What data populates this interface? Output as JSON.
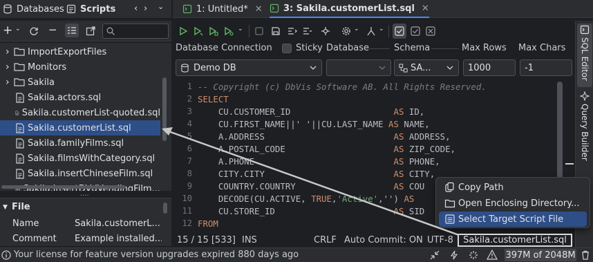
{
  "left_tabs": {
    "databases": "Databases",
    "scripts": "Scripts"
  },
  "tree": [
    {
      "label": "ImportExportFiles",
      "type": "folder"
    },
    {
      "label": "Monitors",
      "type": "folder"
    },
    {
      "label": "Sakila",
      "type": "folder"
    },
    {
      "label": "Sakila.actors.sql",
      "type": "file"
    },
    {
      "label": "Sakila.customerList-quoted.sql",
      "type": "file"
    },
    {
      "label": "Sakila.customerList.sql",
      "type": "file",
      "selected": true
    },
    {
      "label": "Sakila.familyFilms.sql",
      "type": "file"
    },
    {
      "label": "Sakila.filmsWithCategory.sql",
      "type": "file"
    },
    {
      "label": "Sakila.insertChineseFilm.sql",
      "type": "file"
    },
    {
      "label": "Sakila.insertDVdVendingFilm...",
      "type": "file"
    }
  ],
  "file_panel": {
    "title": "File",
    "rows": [
      {
        "key": "Name",
        "value": "Sakila.customerL..."
      },
      {
        "key": "Comment",
        "value": "Example installed..."
      }
    ]
  },
  "editor_tabs": [
    {
      "label": "1: Untitled*",
      "active": false
    },
    {
      "label": "3: Sakila.customerList.sql",
      "active": true
    }
  ],
  "connection": {
    "labels": {
      "db_connection": "Database Connection",
      "sticky": "Sticky",
      "database": "Database",
      "schema": "Schema",
      "max_rows": "Max Rows",
      "max_chars": "Max Chars"
    },
    "db_connection_value": "Demo DB",
    "database_value": "",
    "schema_value": "SA...",
    "max_rows_value": "1000",
    "max_chars_value": "-1"
  },
  "code": {
    "line_numbers": [
      "1",
      "2",
      "3",
      "4",
      "5",
      "6",
      "7",
      "8",
      "9",
      "10",
      "11",
      "12"
    ],
    "lines": [
      [
        {
          "c": "cm",
          "t": "-- Copyright (c) DbVis Software AB. All Rights Reserved."
        }
      ],
      [
        {
          "c": "kw",
          "t": "SELECT"
        }
      ],
      [
        {
          "c": "",
          "t": "    CU.CUSTOMER_ID                    "
        },
        {
          "c": "kw",
          "t": "AS"
        },
        {
          "c": "",
          "t": " ID,"
        }
      ],
      [
        {
          "c": "",
          "t": "    CU.FIRST_NAME||' '||CU.LAST_NAME "
        },
        {
          "c": "kw",
          "t": "AS"
        },
        {
          "c": "",
          "t": " NAME,"
        }
      ],
      [
        {
          "c": "",
          "t": "    A.ADDRESS                         "
        },
        {
          "c": "kw",
          "t": "AS"
        },
        {
          "c": "",
          "t": " ADDRESS,"
        }
      ],
      [
        {
          "c": "",
          "t": "    A.POSTAL_CODE                     "
        },
        {
          "c": "kw",
          "t": "AS"
        },
        {
          "c": "",
          "t": " ZIP_CODE,"
        }
      ],
      [
        {
          "c": "",
          "t": "    A.PHONE                           "
        },
        {
          "c": "kw",
          "t": "AS"
        },
        {
          "c": "",
          "t": " PHONE,"
        }
      ],
      [
        {
          "c": "",
          "t": "    CITY.CITY                         "
        },
        {
          "c": "kw",
          "t": "AS"
        },
        {
          "c": "",
          "t": " CITY,"
        }
      ],
      [
        {
          "c": "",
          "t": "    COUNTRY.COUNTRY                   "
        },
        {
          "c": "kw",
          "t": "AS"
        },
        {
          "c": "",
          "t": " COU"
        }
      ],
      [
        {
          "c": "",
          "t": "    DECODE(CU.ACTIVE, "
        },
        {
          "c": "kw",
          "t": "TRUE"
        },
        {
          "c": "",
          "t": ","
        },
        {
          "c": "str",
          "t": "'Active'"
        },
        {
          "c": "",
          "t": ",'') "
        },
        {
          "c": "kw",
          "t": "AS"
        }
      ],
      [
        {
          "c": "",
          "t": "    CU.STORE_ID                       "
        },
        {
          "c": "kw",
          "t": "AS"
        },
        {
          "c": "",
          "t": " SID"
        }
      ],
      [
        {
          "c": "kw",
          "t": "FROM"
        }
      ]
    ]
  },
  "editor_status": {
    "position": "15 / 15  [533]",
    "mode": "INS",
    "line_sep": "CRLF",
    "auto_commit": "Auto Commit: ON",
    "encoding": "UTF-8",
    "file_name": "Sakila.customerList.sql"
  },
  "context_menu": [
    {
      "label": "Copy Path",
      "icon": "copy-icon"
    },
    {
      "label": "Open Enclosing Directory...",
      "icon": "folder-icon"
    },
    {
      "label": "Select Target Script File",
      "icon": "list-icon",
      "highlighted": true
    }
  ],
  "right_strip": {
    "sql_editor": "SQL Editor",
    "query_builder": "Query Builder"
  },
  "bottom": {
    "license": "Your license for feature version upgrades expired 880 days ago",
    "memory": "397M of 2048M"
  },
  "colors": {
    "accent": "#4a88ff",
    "selection": "#2e4e88",
    "keyword": "#cf8e6d",
    "string": "#6aab73",
    "comment": "#7a7e85",
    "green_run": "#5fb865"
  }
}
